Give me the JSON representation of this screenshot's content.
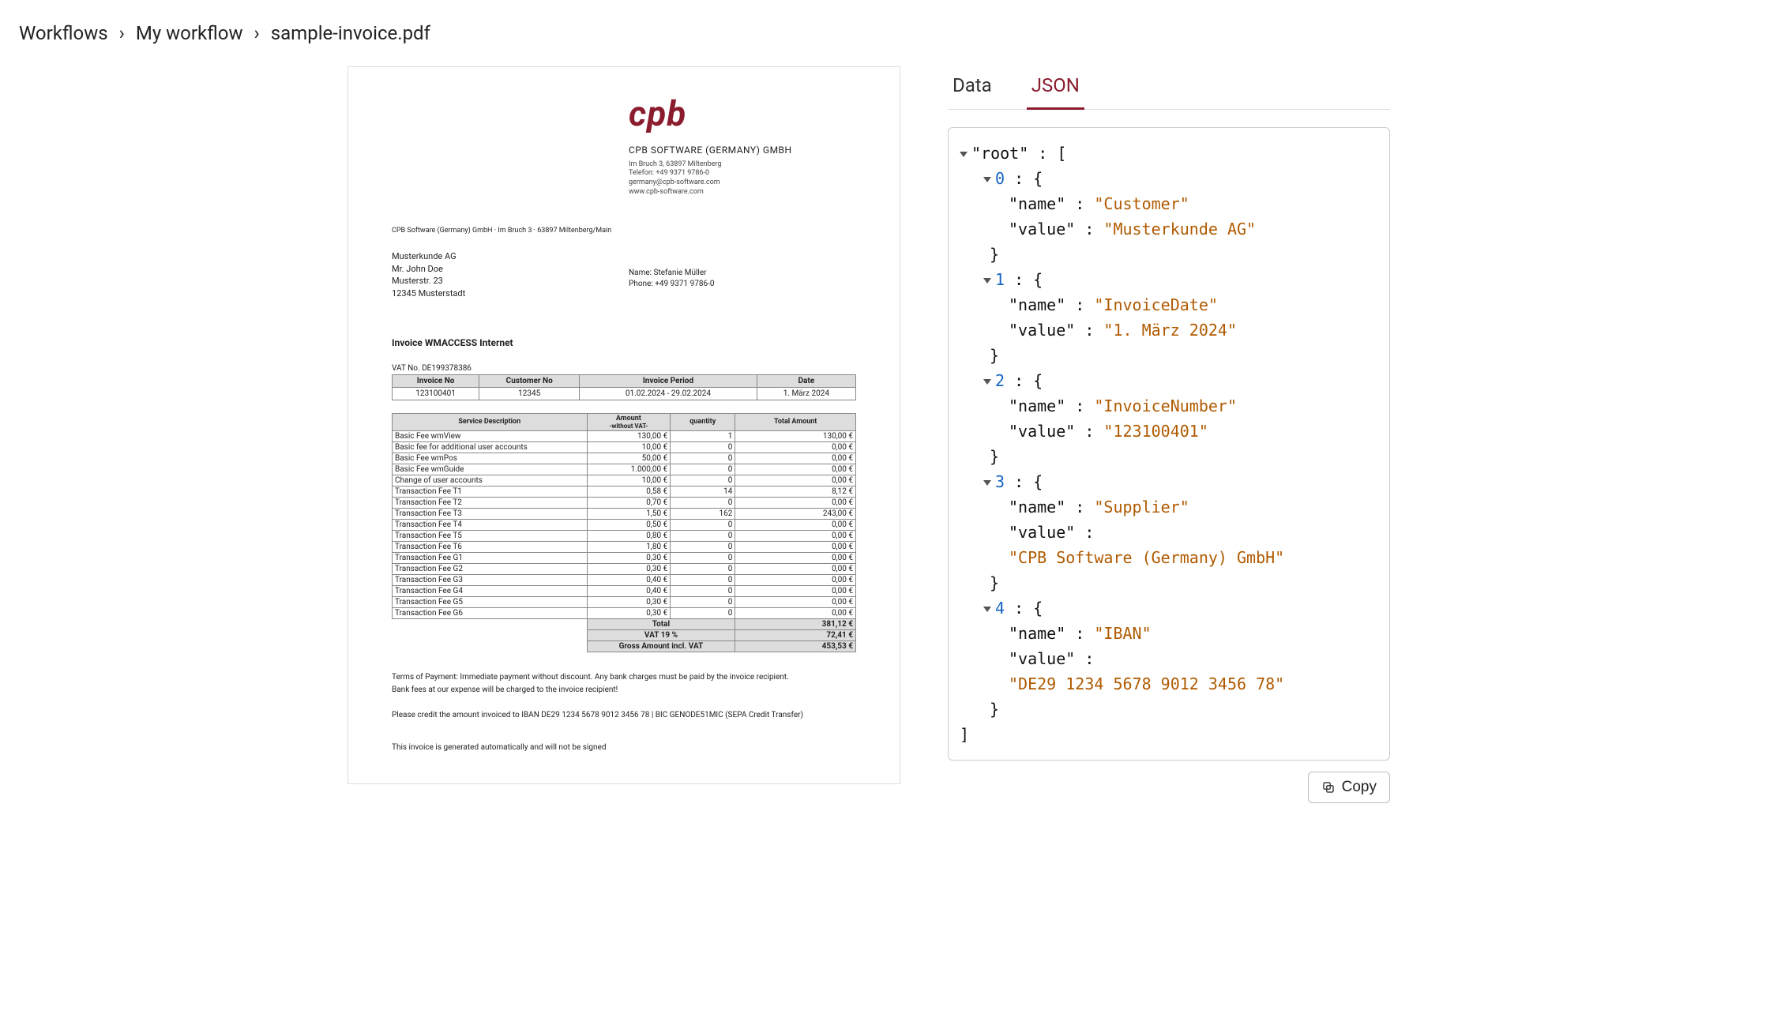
{
  "breadcrumb": {
    "workflows": "Workflows",
    "workflow": "My workflow",
    "file": "sample-invoice.pdf"
  },
  "tabs": {
    "data": "Data",
    "json": "JSON"
  },
  "copy_label": "Copy",
  "json_tree": {
    "root_label": "\"root\"",
    "colon_bracket": " : [",
    "close_bracket": "]",
    "items": [
      {
        "idx": "0",
        "open": " : {",
        "name_key": "\"name\"",
        "name_val": "\"Customer\"",
        "value_key": "\"value\"",
        "value_val": "\"Musterkunde AG\"",
        "close": "}"
      },
      {
        "idx": "1",
        "open": " : {",
        "name_key": "\"name\"",
        "name_val": "\"InvoiceDate\"",
        "value_key": "\"value\"",
        "value_val": "\"1. März 2024\"",
        "close": "}"
      },
      {
        "idx": "2",
        "open": " : {",
        "name_key": "\"name\"",
        "name_val": "\"InvoiceNumber\"",
        "value_key": "\"value\"",
        "value_val": "\"123100401\"",
        "close": "}"
      },
      {
        "idx": "3",
        "open": " : {",
        "name_key": "\"name\"",
        "name_val": "\"Supplier\"",
        "value_key": "\"value\"",
        "value_val": "\"CPB Software (Germany) GmbH\"",
        "close": "}",
        "multiline": true
      },
      {
        "idx": "4",
        "open": " : {",
        "name_key": "\"name\"",
        "name_val": "\"IBAN\"",
        "value_key": "\"value\"",
        "value_val": "\"DE29 1234 5678 9012 3456 78\"",
        "close": "}",
        "multiline": true
      }
    ]
  },
  "doc": {
    "logo": "cpb",
    "company_name": "CPB SOFTWARE (GERMANY) GMBH",
    "company_addr1": "Im Bruch 3, 63897 Miltenberg",
    "company_addr2": "Telefon: +49 9371 9786-0",
    "company_addr3": "germany@cpb-software.com",
    "company_addr4": "www.cpb-software.com",
    "return_addr": "CPB Software (Germany) GmbH · Im Bruch 3 · 63897 Miltenberg/Main",
    "recipient1": "Musterkunde AG",
    "recipient2": "Mr. John Doe",
    "recipient3": "Musterstr. 23",
    "recipient4": "12345 Musterstadt",
    "contact1": "Name:  Stefanie Müller",
    "contact2": "Phone: +49 9371 9786-0",
    "invoice_title": "Invoice WMACCESS Internet",
    "vat_no": "VAT No. DE199378386",
    "info_headers": {
      "inv_no": "Invoice No",
      "cust_no": "Customer No",
      "period": "Invoice Period",
      "date": "Date"
    },
    "info_values": {
      "inv_no": "123100401",
      "cust_no": "12345",
      "period": "01.02.2024 - 29.02.2024",
      "date": "1. März 2024"
    },
    "line_headers": {
      "desc": "Service Description",
      "amount": "Amount",
      "amount_sub": "-without VAT-",
      "qty": "quantity",
      "total": "Total Amount"
    },
    "lines": [
      {
        "desc": "Basic Fee wmView",
        "amount": "130,00 €",
        "qty": "1",
        "total": "130,00 €"
      },
      {
        "desc": "Basic fee for additional user accounts",
        "amount": "10,00 €",
        "qty": "0",
        "total": "0,00 €"
      },
      {
        "desc": "Basic Fee wmPos",
        "amount": "50,00 €",
        "qty": "0",
        "total": "0,00 €"
      },
      {
        "desc": "Basic Fee wmGuide",
        "amount": "1.000,00 €",
        "qty": "0",
        "total": "0,00 €"
      },
      {
        "desc": "Change of user accounts",
        "amount": "10,00 €",
        "qty": "0",
        "total": "0,00 €"
      },
      {
        "desc": "Transaction Fee T1",
        "amount": "0,58 €",
        "qty": "14",
        "total": "8,12 €"
      },
      {
        "desc": "Transaction Fee T2",
        "amount": "0,70 €",
        "qty": "0",
        "total": "0,00 €"
      },
      {
        "desc": "Transaction Fee T3",
        "amount": "1,50 €",
        "qty": "162",
        "total": "243,00 €"
      },
      {
        "desc": "Transaction Fee T4",
        "amount": "0,50 €",
        "qty": "0",
        "total": "0,00 €"
      },
      {
        "desc": "Transaction Fee T5",
        "amount": "0,80 €",
        "qty": "0",
        "total": "0,00 €"
      },
      {
        "desc": "Transaction Fee T6",
        "amount": "1,80 €",
        "qty": "0",
        "total": "0,00 €"
      },
      {
        "desc": "Transaction Fee G1",
        "amount": "0,30 €",
        "qty": "0",
        "total": "0,00 €"
      },
      {
        "desc": "Transaction Fee G2",
        "amount": "0,30 €",
        "qty": "0",
        "total": "0,00 €"
      },
      {
        "desc": "Transaction Fee G3",
        "amount": "0,40 €",
        "qty": "0",
        "total": "0,00 €"
      },
      {
        "desc": "Transaction Fee G4",
        "amount": "0,40 €",
        "qty": "0",
        "total": "0,00 €"
      },
      {
        "desc": "Transaction Fee G5",
        "amount": "0,30 €",
        "qty": "0",
        "total": "0,00 €"
      },
      {
        "desc": "Transaction Fee G6",
        "amount": "0,30 €",
        "qty": "0",
        "total": "0,00 €"
      }
    ],
    "totals": {
      "total_label": "Total",
      "total": "381,12 €",
      "vat_label": "VAT 19 %",
      "vat": "72,41 €",
      "gross_label": "Gross Amount incl. VAT",
      "gross": "453,53 €"
    },
    "terms1": "Terms of Payment: Immediate payment without discount. Any bank charges must be paid by the invoice recipient.",
    "terms2": "Bank fees at our expense will be charged to the invoice recipient!",
    "pay_instr": "Please credit the amount invoiced to IBAN DE29 1234 5678 9012 3456 78 | BIC GENODE51MIC (SEPA Credit Transfer)",
    "auto_note": "This invoice is generated automatically and will not be signed"
  }
}
